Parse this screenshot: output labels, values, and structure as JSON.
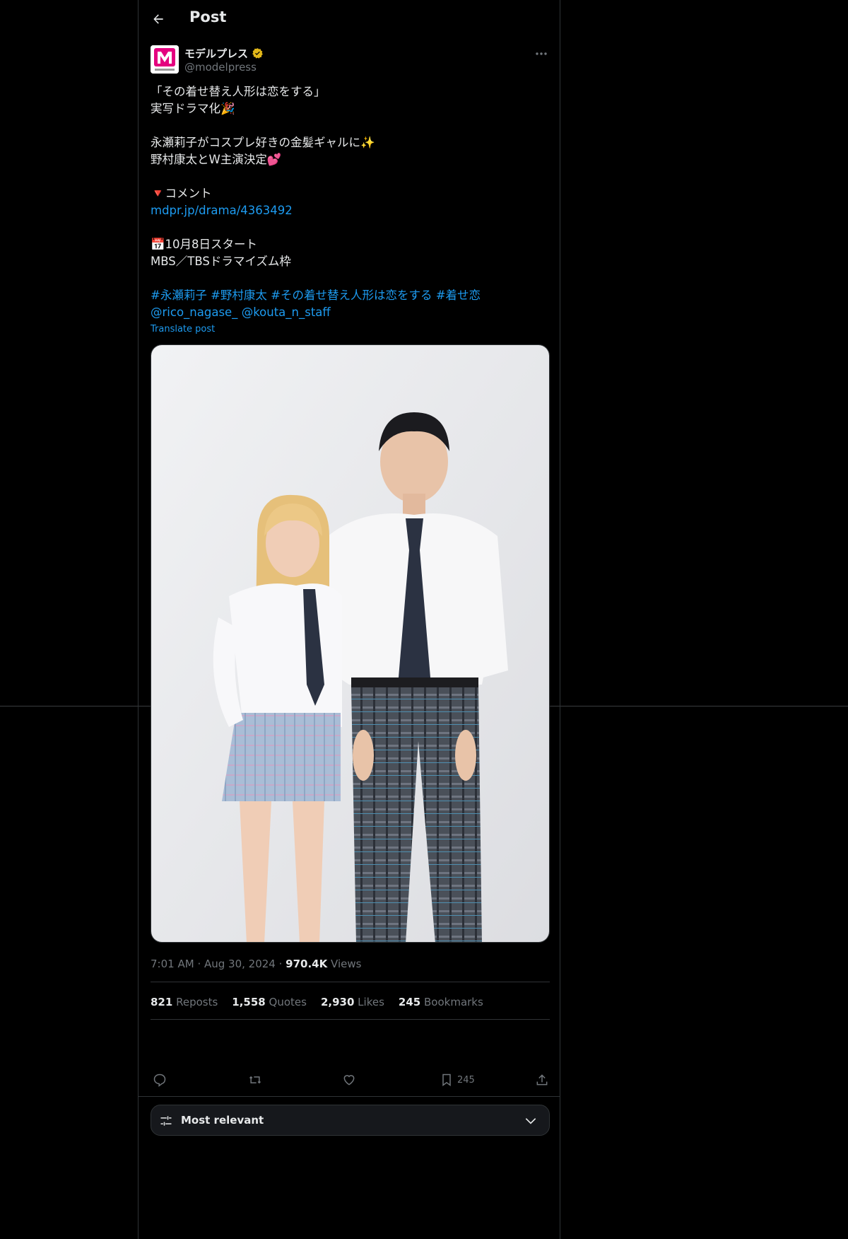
{
  "header": {
    "title": "Post"
  },
  "author": {
    "display_name": "モデルプレス",
    "handle": "@modelpress",
    "avatar_text": "modelpress"
  },
  "post": {
    "lines": [
      "「その着せ替え人形は恋をする」",
      "実写ドラマ化🎉",
      "",
      "永瀬莉子がコスプレ好きの金髪ギャルに✨",
      "野村康太とW主演決定💕",
      "",
      "🔻コメント"
    ],
    "link": "mdpr.jp/drama/4363492",
    "lines2": [
      "📅10月8日スタート",
      "MBS／TBSドラマイズム枠"
    ],
    "hashtags": [
      "#永瀬莉子",
      "#野村康太",
      "#その着せ替え人形は恋をする",
      "#着せ恋"
    ],
    "mentions": [
      "@rico_nagase_",
      "@kouta_n_staff"
    ],
    "translate": "Translate post"
  },
  "meta": {
    "time": "7:01 AM",
    "date": "Aug 30, 2024",
    "views_count": "970.4K",
    "views_label": "Views"
  },
  "stats": [
    {
      "count": "821",
      "label": "Reposts"
    },
    {
      "count": "1,558",
      "label": "Quotes"
    },
    {
      "count": "2,930",
      "label": "Likes"
    },
    {
      "count": "245",
      "label": "Bookmarks"
    }
  ],
  "actions": {
    "bookmark_count": "245"
  },
  "sort": {
    "label": "Most relevant"
  },
  "colors": {
    "link": "#1d9bf0",
    "muted": "#71767b",
    "text": "#e7e9ea",
    "background": "#000000"
  }
}
